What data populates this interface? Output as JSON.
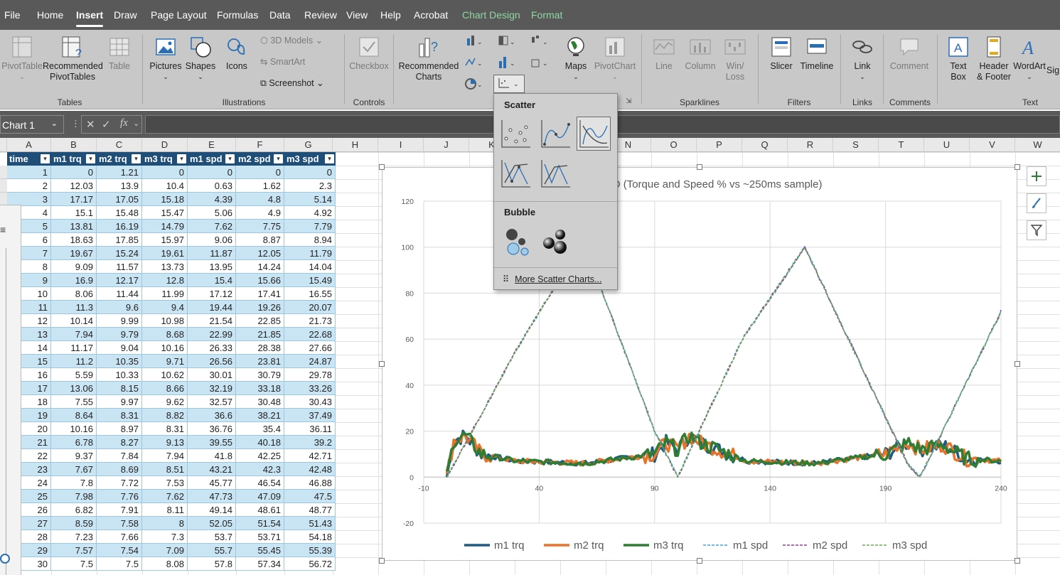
{
  "menu": {
    "items": [
      "File",
      "Home",
      "Insert",
      "Draw",
      "Page Layout",
      "Formulas",
      "Data",
      "Review",
      "View",
      "Help",
      "Acrobat",
      "Chart Design",
      "Format"
    ]
  },
  "ribbon": {
    "pivottable": "PivotTable",
    "rec_pivot": "Recommended PivotTables",
    "table": "Table",
    "pictures": "Pictures",
    "shapes": "Shapes",
    "icons": "Icons",
    "models3d": "3D Models",
    "smartart": "SmartArt",
    "screenshot": "Screenshot",
    "checkbox": "Checkbox",
    "rec_charts": "Recommended Charts",
    "maps": "Maps",
    "pivotchart": "PivotChart",
    "line": "Line",
    "column": "Column",
    "winloss": "Win/ Loss",
    "slicer": "Slicer",
    "timeline": "Timeline",
    "link": "Link",
    "comment": "Comment",
    "textbox": "Text Box",
    "headerfooter": "Header & Footer",
    "wordart": "WordArt",
    "sig": "Sig",
    "groups": {
      "tables": "Tables",
      "illustrations": "Illustrations",
      "controls": "Controls",
      "sparklines": "Sparklines",
      "filters": "Filters",
      "links": "Links",
      "comments": "Comments",
      "text": "Text"
    }
  },
  "formula_bar": {
    "name_box": "Chart 1",
    "fx": "fx"
  },
  "columns": [
    "A",
    "B",
    "C",
    "D",
    "E",
    "F",
    "G",
    "H",
    "I",
    "J",
    "K",
    "L",
    "M",
    "N",
    "O",
    "P",
    "Q",
    "R",
    "S",
    "T",
    "U",
    "V",
    "W"
  ],
  "table": {
    "headers": [
      "time",
      "m1 trq",
      "m2 trq",
      "m3 trq",
      "m1 spd",
      "m2 spd",
      "m3 spd"
    ],
    "rows": [
      [
        "1",
        "0",
        "1.21",
        "0",
        "0",
        "0",
        "0"
      ],
      [
        "2",
        "12.03",
        "13.9",
        "10.4",
        "0.63",
        "1.62",
        "2.3"
      ],
      [
        "3",
        "17.17",
        "17.05",
        "15.18",
        "4.39",
        "4.8",
        "5.14"
      ],
      [
        "4",
        "15.1",
        "15.48",
        "15.47",
        "5.06",
        "4.9",
        "4.92"
      ],
      [
        "5",
        "13.81",
        "16.19",
        "14.79",
        "7.62",
        "7.75",
        "7.79"
      ],
      [
        "6",
        "18.63",
        "17.85",
        "15.97",
        "9.06",
        "8.87",
        "8.94"
      ],
      [
        "7",
        "19.67",
        "15.24",
        "19.61",
        "11.87",
        "12.05",
        "11.79"
      ],
      [
        "8",
        "9.09",
        "11.57",
        "13.73",
        "13.95",
        "14.24",
        "14.04"
      ],
      [
        "9",
        "16.9",
        "12.17",
        "12.8",
        "15.4",
        "15.66",
        "15.49"
      ],
      [
        "10",
        "8.06",
        "11.44",
        "11.99",
        "17.12",
        "17.41",
        "16.55"
      ],
      [
        "11",
        "11.3",
        "9.6",
        "9.4",
        "19.44",
        "19.26",
        "20.07"
      ],
      [
        "12",
        "10.14",
        "9.99",
        "10.98",
        "21.54",
        "22.85",
        "21.73"
      ],
      [
        "13",
        "7.94",
        "9.79",
        "8.68",
        "22.99",
        "21.85",
        "22.68"
      ],
      [
        "14",
        "11.17",
        "9.04",
        "10.16",
        "26.33",
        "28.38",
        "27.66"
      ],
      [
        "15",
        "11.2",
        "10.35",
        "9.71",
        "26.56",
        "23.81",
        "24.87"
      ],
      [
        "16",
        "5.59",
        "10.33",
        "10.62",
        "30.01",
        "30.79",
        "29.78"
      ],
      [
        "17",
        "13.06",
        "8.15",
        "8.66",
        "32.19",
        "33.18",
        "33.26"
      ],
      [
        "18",
        "7.55",
        "9.97",
        "9.62",
        "32.57",
        "30.48",
        "30.43"
      ],
      [
        "19",
        "8.64",
        "8.31",
        "8.82",
        "36.6",
        "38.21",
        "37.49"
      ],
      [
        "20",
        "10.16",
        "8.97",
        "8.31",
        "36.76",
        "35.4",
        "36.11"
      ],
      [
        "21",
        "6.78",
        "8.27",
        "9.13",
        "39.55",
        "40.18",
        "39.2"
      ],
      [
        "22",
        "9.37",
        "7.84",
        "7.94",
        "41.8",
        "42.25",
        "42.71"
      ],
      [
        "23",
        "7.67",
        "8.69",
        "8.51",
        "43.21",
        "42.3",
        "42.48"
      ],
      [
        "24",
        "7.8",
        "7.72",
        "7.53",
        "45.77",
        "46.54",
        "46.88"
      ],
      [
        "25",
        "7.98",
        "7.76",
        "7.62",
        "47.73",
        "47.09",
        "47.5"
      ],
      [
        "26",
        "6.82",
        "7.91",
        "8.11",
        "49.14",
        "48.61",
        "48.77"
      ],
      [
        "27",
        "8.59",
        "7.58",
        "8",
        "52.05",
        "51.54",
        "51.43"
      ],
      [
        "28",
        "7.23",
        "7.66",
        "7.3",
        "53.7",
        "53.71",
        "54.18"
      ],
      [
        "29",
        "7.57",
        "7.54",
        "7.09",
        "55.7",
        "55.45",
        "55.39"
      ],
      [
        "30",
        "7.5",
        "7.5",
        "8.08",
        "57.8",
        "57.34",
        "56.72"
      ]
    ]
  },
  "dropdown": {
    "scatter_label": "Scatter",
    "bubble_label": "Bubble",
    "more": "More Scatter Charts..."
  },
  "chart_data": {
    "type": "scatter",
    "title": "PID (Torque and Speed % vs ~250ms sample)",
    "xlim": [
      -10,
      240
    ],
    "ylim": [
      -20,
      120
    ],
    "x_ticks": [
      "-10",
      "40",
      "90",
      "140",
      "190",
      "240"
    ],
    "y_ticks": [
      "120",
      "100",
      "80",
      "60",
      "40",
      "20",
      "0",
      "-20"
    ],
    "series": [
      {
        "name": "m1 trq",
        "color": "#1f5c85",
        "style": "solid-thick"
      },
      {
        "name": "m2 trq",
        "color": "#e8742c",
        "style": "solid-thick"
      },
      {
        "name": "m3 trq",
        "color": "#2e7d32",
        "style": "solid-thick"
      },
      {
        "name": "m1 spd",
        "color": "#3fa4d8",
        "style": "dashed"
      },
      {
        "name": "m2 spd",
        "color": "#8e3a8e",
        "style": "dashed"
      },
      {
        "name": "m3 spd",
        "color": "#6aa84f",
        "style": "dashed"
      }
    ],
    "speed_profile": [
      [
        0,
        0
      ],
      [
        30,
        55
      ],
      [
        45,
        80
      ],
      [
        60,
        100
      ],
      [
        90,
        20
      ],
      [
        95,
        10
      ],
      [
        100,
        0
      ],
      [
        128,
        60
      ],
      [
        155,
        100
      ],
      [
        200,
        5
      ],
      [
        205,
        0
      ],
      [
        240,
        72
      ]
    ],
    "torque_profile": [
      [
        0,
        0
      ],
      [
        3,
        16
      ],
      [
        8,
        18
      ],
      [
        15,
        10
      ],
      [
        30,
        7
      ],
      [
        60,
        6
      ],
      [
        90,
        10
      ],
      [
        95,
        15
      ],
      [
        100,
        12
      ],
      [
        105,
        18
      ],
      [
        110,
        15
      ],
      [
        130,
        7
      ],
      [
        160,
        6
      ],
      [
        190,
        10
      ],
      [
        200,
        15
      ],
      [
        205,
        12
      ],
      [
        215,
        14
      ],
      [
        225,
        8
      ],
      [
        240,
        7
      ]
    ]
  }
}
